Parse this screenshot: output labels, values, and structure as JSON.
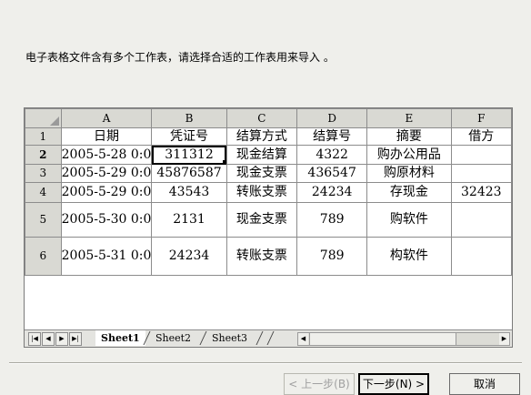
{
  "instruction": "电子表格文件含有多个工作表，请选择合适的工作表用来导入 。",
  "grid": {
    "columns": [
      "A",
      "B",
      "C",
      "D",
      "E",
      "F"
    ],
    "rows": [
      {
        "num": "1",
        "cells": [
          "日期",
          "凭证号",
          "结算方式",
          "结算号",
          "摘要",
          "借方"
        ]
      },
      {
        "num": "2",
        "cells": [
          "2005-5-28 0:0",
          "311312",
          "现金结算",
          "4322",
          "购办公用品",
          ""
        ]
      },
      {
        "num": "3",
        "cells": [
          "2005-5-29 0:0",
          "45876587",
          "现金支票",
          "436547",
          "购原材料",
          ""
        ]
      },
      {
        "num": "4",
        "cells": [
          "2005-5-29 0:0",
          "43543",
          "转账支票",
          "24234",
          "存现金",
          "32423"
        ]
      },
      {
        "num": "5",
        "cells": [
          "2005-5-30 0:0",
          "2131",
          "现金支票",
          "789",
          "购软件",
          ""
        ]
      },
      {
        "num": "6",
        "cells": [
          "2005-5-31 0:0",
          "24234",
          "转账支票",
          "789",
          "构软件",
          ""
        ]
      }
    ]
  },
  "tabs": [
    "Sheet1",
    "Sheet2",
    "Sheet3"
  ],
  "buttons": {
    "back": "< 上一步(B)",
    "next": "下一步(N) >",
    "cancel": "取消"
  }
}
